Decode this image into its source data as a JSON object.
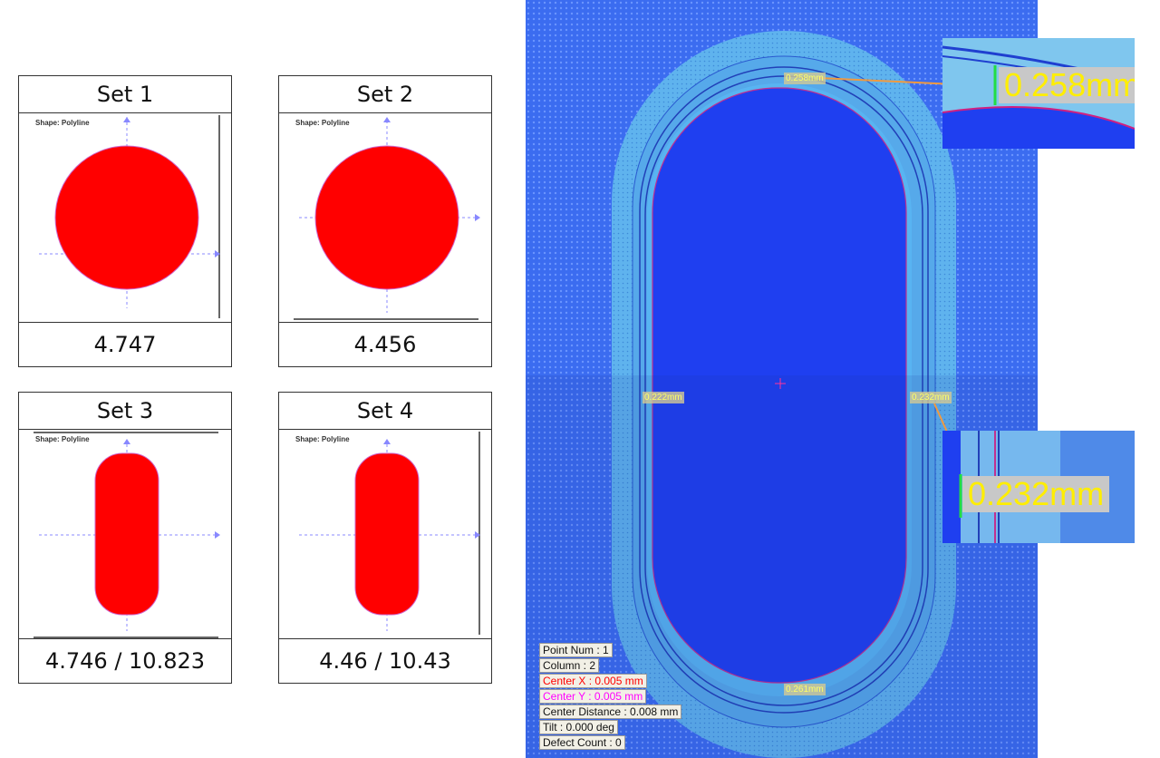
{
  "sets": [
    {
      "title": "Set 1",
      "value": "4.747",
      "shape_label": "Shape: Polyline",
      "shape": "circle"
    },
    {
      "title": "Set 2",
      "value": "4.456",
      "shape_label": "Shape: Polyline",
      "shape": "circle"
    },
    {
      "title": "Set 3",
      "value": "4.746 / 10.823",
      "shape_label": "Shape: Polyline",
      "shape": "obround"
    },
    {
      "title": "Set 4",
      "value": "4.46 / 10.43",
      "shape_label": "Shape: Polyline",
      "shape": "obround"
    }
  ],
  "inspection": {
    "labels": {
      "top": "0.258mm",
      "left": "0.222mm",
      "right": "0.232mm",
      "bottom": "0.261mm"
    },
    "zoom_top": "0.258mm",
    "zoom_right": "0.232mm"
  },
  "info": {
    "point_num": "Point Num : 1",
    "column": "Column : 2",
    "center_x": "Center X : 0.005 mm",
    "center_y": "Center Y : 0.005 mm",
    "center_distance": "Center Distance : 0.008 mm",
    "tilt": "Tilt : 0.000 deg",
    "defect_count": "Defect Count : 0"
  },
  "colors": {
    "shape_fill": "#ff0000",
    "background_blue": "#3b6cf0",
    "ring_cyan": "#5cc0f0",
    "inner_blue": "#1f3ff0",
    "arrow_orange": "#f09a40",
    "label_yellow": "#ffff33",
    "center_x_red": "#ff0000",
    "center_y_magenta": "#ff00ff"
  }
}
